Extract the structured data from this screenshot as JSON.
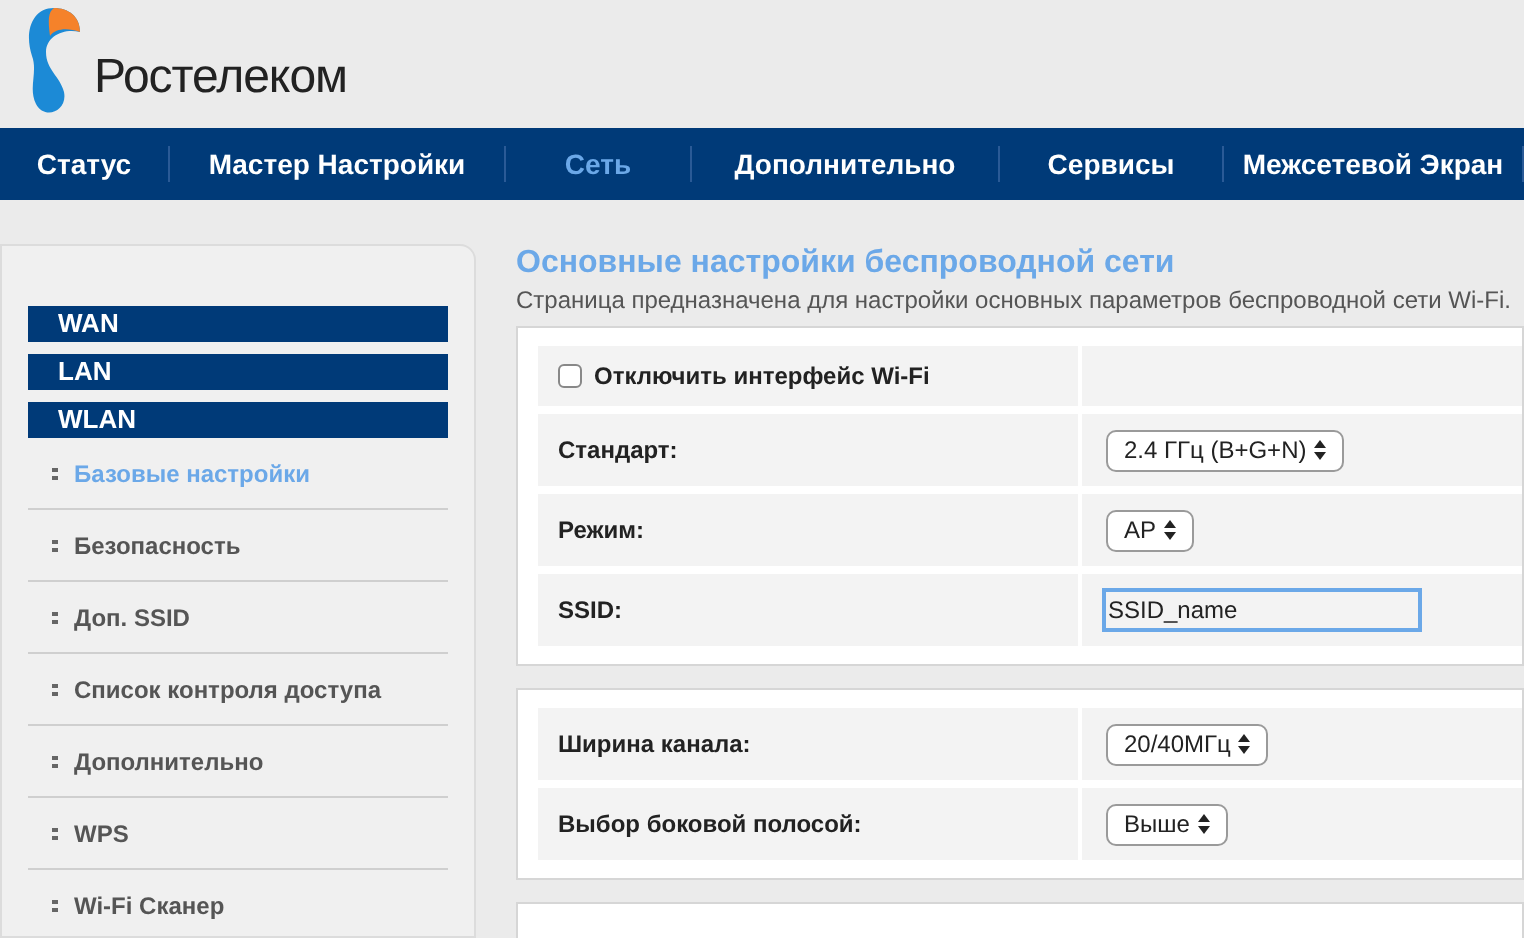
{
  "logo": {
    "text": "Ростелеком"
  },
  "nav": [
    {
      "label": "Статус",
      "selected": false
    },
    {
      "label": "Мастер Настройки",
      "selected": false
    },
    {
      "label": "Сеть",
      "selected": true
    },
    {
      "label": "Дополнительно",
      "selected": false
    },
    {
      "label": "Сервисы",
      "selected": false
    },
    {
      "label": "Межсетевой Экран",
      "selected": false
    }
  ],
  "sidebar": {
    "sections": [
      "WAN",
      "LAN",
      "WLAN"
    ],
    "items": [
      {
        "label": "Базовые настройки",
        "selected": true
      },
      {
        "label": "Безопасность",
        "selected": false
      },
      {
        "label": "Доп. SSID",
        "selected": false
      },
      {
        "label": "Список контроля доступа",
        "selected": false
      },
      {
        "label": "Дополнительно",
        "selected": false
      },
      {
        "label": "WPS",
        "selected": false
      },
      {
        "label": "Wi-Fi Сканер",
        "selected": false
      }
    ]
  },
  "page": {
    "title": "Основные настройки беспроводной сети",
    "description": "Страница предназначена для настройки основных параметров беспроводной сети Wi-Fi."
  },
  "cards": [
    {
      "rows": [
        {
          "kind": "checkbox",
          "label": "Отключить интерфейс Wi-Fi",
          "checked": false
        },
        {
          "kind": "select",
          "label": "Стандарт:",
          "value": "2.4 ГГц (B+G+N)"
        },
        {
          "kind": "select",
          "label": "Режим:",
          "value": "AP"
        },
        {
          "kind": "text",
          "label": "SSID:",
          "value": "SSID_name"
        }
      ]
    },
    {
      "rows": [
        {
          "kind": "select",
          "label": "Ширина канала:",
          "value": "20/40МГц"
        },
        {
          "kind": "select",
          "label": "Выбор боковой полосой:",
          "value": "Выше"
        }
      ]
    }
  ]
}
